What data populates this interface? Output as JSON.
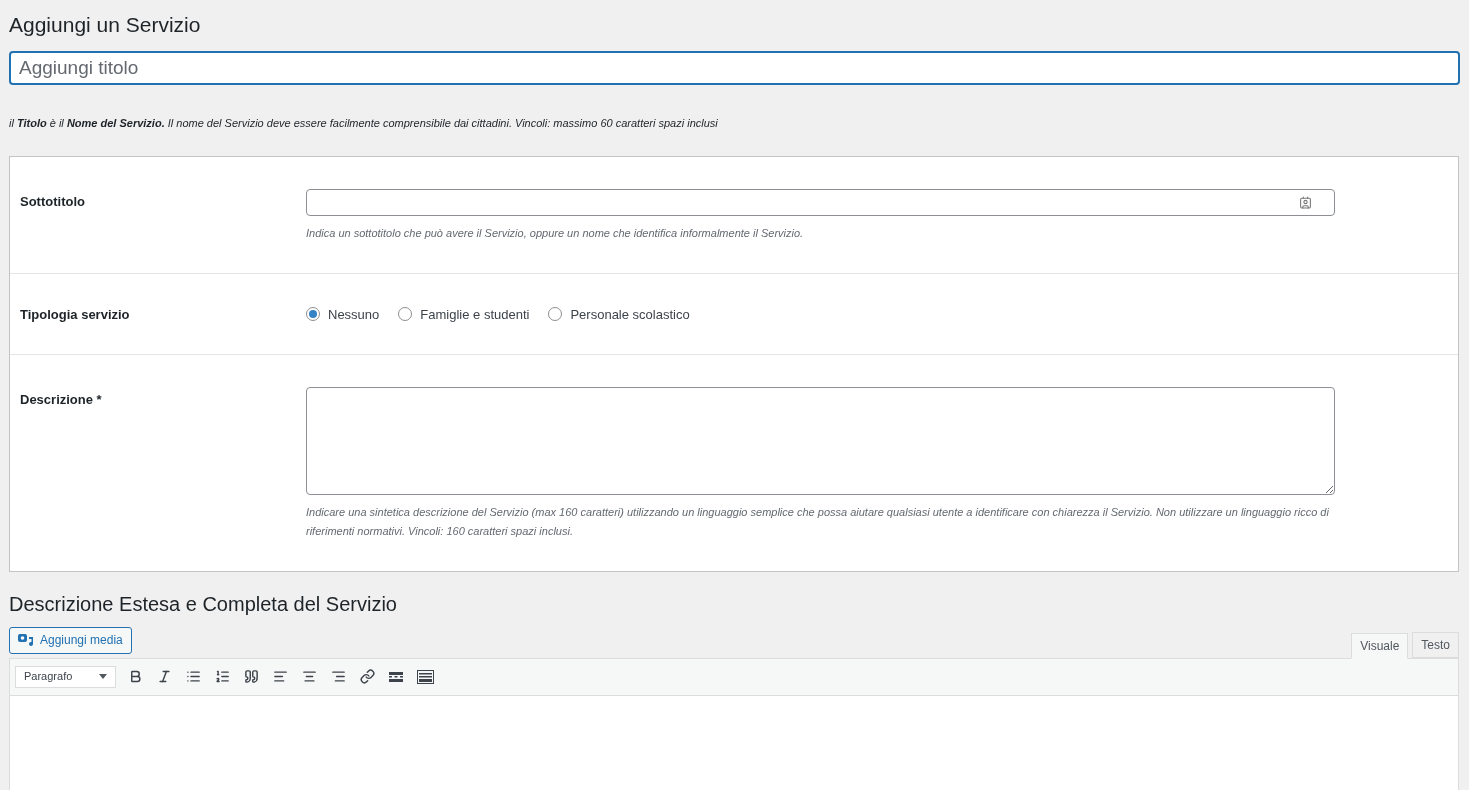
{
  "page_title": "Aggiungi un Servizio",
  "title_field": {
    "placeholder": "Aggiungi titolo"
  },
  "title_hint": "il **Titolo** è il **Nome del Servizio.** Il nome del Servizio deve essere facilmente comprensibile dai cittadini. Vincoli: massimo 60 caratteri spazi inclusi",
  "fields": [
    {
      "kind": "text",
      "label": "Sottotitolo",
      "hint": "Indica un sottotitolo che può avere il Servizio, oppure un nome che identifica informalmente il Servizio."
    },
    {
      "kind": "radio",
      "label": "Tipologia servizio",
      "options": [
        {
          "label": "Nessuno",
          "selected": true
        },
        {
          "label": "Famiglie e studenti",
          "selected": false
        },
        {
          "label": "Personale scolastico",
          "selected": false
        }
      ]
    },
    {
      "kind": "textarea",
      "label": "Descrizione *",
      "hint": "Indicare una sintetica descrizione del Servizio (max 160 caratteri) utilizzando un linguaggio semplice che possa aiutare qualsiasi utente a identificare con chiarezza il Servizio. Non utilizzare un linguaggio ricco di riferimenti normativi. Vincoli: 160 caratteri spazi inclusi."
    }
  ],
  "editor": {
    "heading": "Descrizione Estesa e Completa del Servizio",
    "media_button": "Aggiungi media",
    "tabs": [
      {
        "label": "Visuale",
        "selected": true
      },
      {
        "label": "Testo",
        "selected": false
      }
    ],
    "format_select": "Paragrafo"
  }
}
